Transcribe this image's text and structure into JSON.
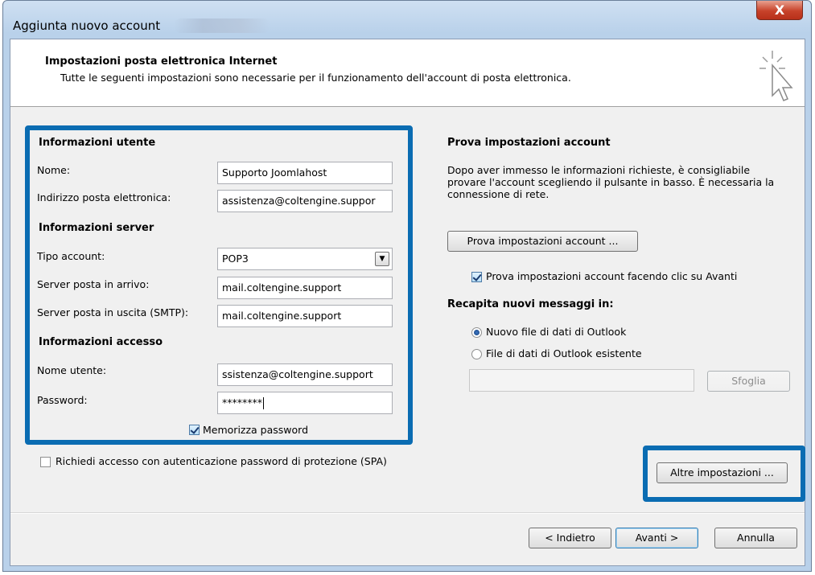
{
  "window": {
    "title": "Aggiunta nuovo account",
    "close_label": "X"
  },
  "header": {
    "title": "Impostazioni posta elettronica Internet",
    "subtitle": "Tutte le seguenti impostazioni sono necessarie per il funzionamento dell'account di posta elettronica."
  },
  "user_info": {
    "section": "Informazioni utente",
    "name_label": "Nome:",
    "name_value": "Supporto Joomlahost",
    "email_label": "Indirizzo posta elettronica:",
    "email_value": "assistenza@coltengine.suppor"
  },
  "server_info": {
    "section": "Informazioni server",
    "account_type_label": "Tipo account:",
    "account_type_value": "POP3",
    "incoming_label": "Server posta in arrivo:",
    "incoming_value": "mail.coltengine.support",
    "outgoing_label": "Server posta in uscita (SMTP):",
    "outgoing_value": "mail.coltengine.support"
  },
  "access_info": {
    "section": "Informazioni accesso",
    "username_label": "Nome utente:",
    "username_value": "ssistenza@coltengine.support",
    "password_label": "Password:",
    "password_value": "********",
    "remember_label": "Memorizza password",
    "remember_checked": true
  },
  "spa": {
    "label": "Richiedi accesso con autenticazione password di protezione (SPA)",
    "checked": false
  },
  "test": {
    "section": "Prova impostazioni account",
    "description": "Dopo aver immesso le informazioni richieste, è consigliabile provare l'account scegliendo il pulsante in basso. È necessaria la connessione di rete.",
    "button": "Prova impostazioni account ...",
    "auto_label": "Prova impostazioni account facendo clic su Avanti",
    "auto_checked": true
  },
  "deliver": {
    "section": "Recapita nuovi messaggi in:",
    "new_file_label": "Nuovo file di dati di Outlook",
    "existing_file_label": "File di dati di Outlook esistente",
    "selected": "new",
    "path_value": "",
    "browse_button": "Sfoglia"
  },
  "more_settings_button": "Altre impostazioni ...",
  "footer": {
    "back": "< Indietro",
    "next": "Avanti >",
    "cancel": "Annulla"
  },
  "colors": {
    "highlight": "#0a6cb2",
    "title_bar": "#b9d1ea",
    "close": "#c7422a"
  }
}
